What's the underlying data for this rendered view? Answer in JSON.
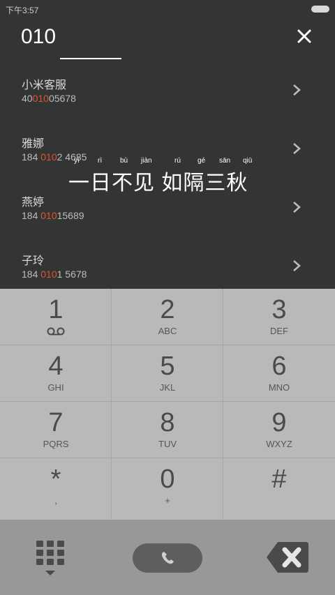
{
  "status_bar": {
    "time": "下午3:57"
  },
  "search": {
    "query": "010"
  },
  "results": [
    {
      "name": "小米客服",
      "number_pre": "40",
      "number_hl": "010",
      "number_post": "05678"
    },
    {
      "name": "雅娜",
      "number_pre": "184 ",
      "number_hl": "010",
      "number_post": "2 4685"
    },
    {
      "name": "燕婷",
      "number_pre": "184 ",
      "number_hl": "010",
      "number_post": "15689"
    },
    {
      "name": "子玲",
      "number_pre": "184 ",
      "number_hl": "010",
      "number_post": "1 5678"
    }
  ],
  "overlay": {
    "pinyin": [
      "yī",
      "rì",
      "bù",
      "jiàn",
      "rú",
      "gé",
      "sān",
      "qiū"
    ],
    "idiom": "一日不见 如隔三秋"
  },
  "dialpad": {
    "keys": [
      {
        "digit": "1",
        "letters": ""
      },
      {
        "digit": "2",
        "letters": "ABC"
      },
      {
        "digit": "3",
        "letters": "DEF"
      },
      {
        "digit": "4",
        "letters": "GHI"
      },
      {
        "digit": "5",
        "letters": "JKL"
      },
      {
        "digit": "6",
        "letters": "MNO"
      },
      {
        "digit": "7",
        "letters": "PQRS"
      },
      {
        "digit": "8",
        "letters": "TUV"
      },
      {
        "digit": "9",
        "letters": "WXYZ"
      },
      {
        "digit": "*",
        "letters": ","
      },
      {
        "digit": "0",
        "letters": "+"
      },
      {
        "digit": "#",
        "letters": ""
      }
    ]
  },
  "icons": {
    "close": "close-icon",
    "chevron": "chevron-right-icon",
    "voicemail": "voicemail-icon",
    "dialpad": "dialpad-grid-icon",
    "call": "phone-icon",
    "delete": "backspace-icon"
  },
  "colors": {
    "highlight": "#e0562a",
    "background": "#333434",
    "dialpad": "#b9b9b9",
    "bottom_bar": "#989898"
  }
}
